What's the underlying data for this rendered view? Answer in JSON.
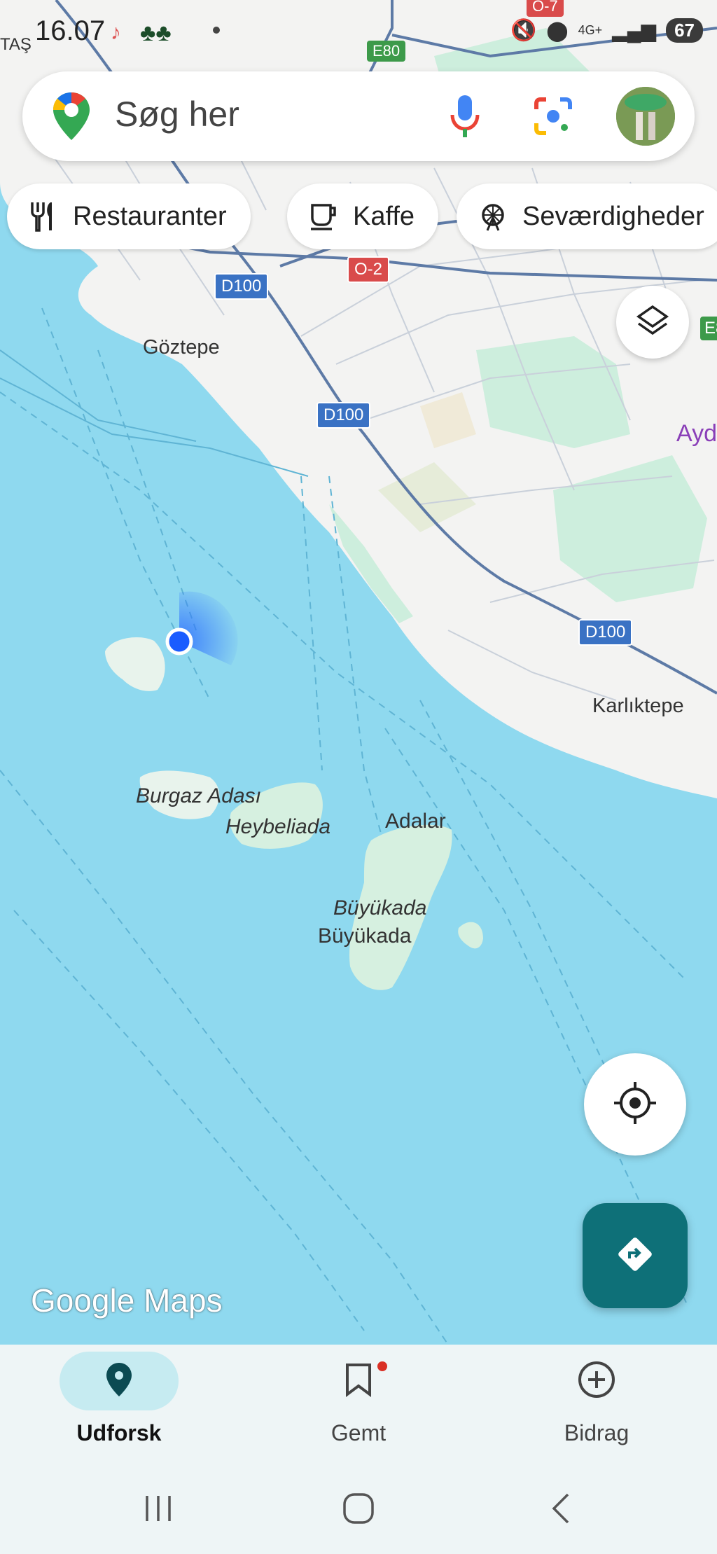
{
  "status_bar": {
    "carrier_fragment": "TAŞ",
    "time": "16.07",
    "network": "4G+",
    "battery": "67"
  },
  "search": {
    "placeholder": "Søg her"
  },
  "chips": [
    {
      "label": "Restauranter",
      "icon": "fork-knife-icon"
    },
    {
      "label": "Kaffe",
      "icon": "coffee-cup-icon"
    },
    {
      "label": "Seværdigheder",
      "icon": "ferris-wheel-icon"
    }
  ],
  "map": {
    "road_labels": [
      "E80",
      "O-7",
      "D100",
      "O-2",
      "D100",
      "D100",
      "E8"
    ],
    "place_labels": [
      "Göztepe",
      "Karlıktepe",
      "Ayd"
    ],
    "island_labels": [
      "Burgaz Adası",
      "Heybeliada",
      "Adalar",
      "Büyükada",
      "Büyükada"
    ],
    "watermark": "Google Maps",
    "colors": {
      "water": "#8fd9ef",
      "land": "#f3f3f2",
      "park": "#cdeedd",
      "road": "#4f6f9a",
      "highway_shield": "#3a72c4",
      "ring_shield": "#d94b4b",
      "location_dot": "#1a5cff"
    }
  },
  "bottom_nav": {
    "items": [
      {
        "label": "Udforsk",
        "icon": "explore-pin-icon",
        "active": true
      },
      {
        "label": "Gemt",
        "icon": "bookmark-icon",
        "active": false,
        "badge": true
      },
      {
        "label": "Bidrag",
        "icon": "add-circle-icon",
        "active": false
      }
    ]
  },
  "system_nav": [
    "recent-apps-icon",
    "home-icon",
    "back-icon"
  ]
}
